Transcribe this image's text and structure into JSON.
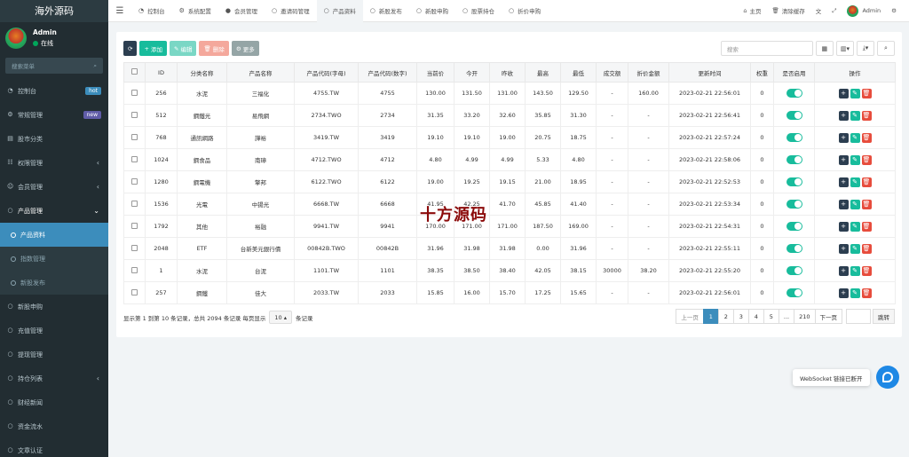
{
  "sidebar": {
    "logo": "海外源码",
    "user": {
      "name": "Admin",
      "status": "在线"
    },
    "search_placeholder": "搜索菜单",
    "menu": [
      {
        "label": "控制台",
        "icon": "dashboard-icon",
        "badge": "hot",
        "badge_color": "#3c8dbc"
      },
      {
        "label": "常规管理",
        "icon": "cogs-icon",
        "badge": "new",
        "badge_color": "#605ca8"
      },
      {
        "label": "股市分类",
        "icon": "folder-icon"
      },
      {
        "label": "权限管理",
        "icon": "group-icon",
        "arrow": "‹"
      },
      {
        "label": "会员管理",
        "icon": "users-icon",
        "arrow": "‹"
      }
    ],
    "open_menu": {
      "label": "产品管理",
      "arrow": "⌄"
    },
    "submenu": [
      {
        "label": "产品资料",
        "active": true
      },
      {
        "label": "指数管理",
        "active": false
      },
      {
        "label": "新股发布",
        "active": false
      }
    ],
    "menu_after": [
      {
        "label": "新股申购",
        "icon": "circle-icon"
      },
      {
        "label": "充值管理",
        "icon": "circle-icon"
      },
      {
        "label": "提现管理",
        "icon": "circle-icon"
      },
      {
        "label": "持仓列表",
        "icon": "circle-icon",
        "arrow": "‹"
      },
      {
        "label": "财经新闻",
        "icon": "circle-icon"
      },
      {
        "label": "资金流水",
        "icon": "circle-icon"
      },
      {
        "label": "文章认证",
        "icon": "circle-icon"
      }
    ]
  },
  "topbar": {
    "tabs": [
      {
        "label": "控制台",
        "icon": "dashboard-icon"
      },
      {
        "label": "系统配置",
        "icon": "cog-icon"
      },
      {
        "label": "会员管理",
        "icon": "user-icon"
      },
      {
        "label": "邀请码管理",
        "icon": "circle-icon"
      },
      {
        "label": "产品资料",
        "icon": "circle-icon",
        "active": true
      },
      {
        "label": "新股发布",
        "icon": "circle-icon"
      },
      {
        "label": "新股申购",
        "icon": "circle-icon"
      },
      {
        "label": "股票持仓",
        "icon": "circle-icon"
      },
      {
        "label": "折价申购",
        "icon": "circle-icon"
      }
    ],
    "home": "主页",
    "clear_cache": "清除缓存",
    "admin": "Admin"
  },
  "toolbar": {
    "refresh": "⟳",
    "add": "添加",
    "edit": "编辑",
    "delete": "删除",
    "more": "更多",
    "search_placeholder": "搜索"
  },
  "colors": {
    "refresh": "#2c3e50",
    "add": "#18bc9c",
    "edit": "#7ad7c5",
    "delete": "#f4a89c",
    "more": "#95a5a6",
    "op_add": "#2c3e50",
    "op_edit": "#18bc9c",
    "op_delete": "#e74c3c"
  },
  "table": {
    "headers": [
      "",
      "ID",
      "分类名称",
      "产品名称",
      "产品代码(字母)",
      "产品代码(数字)",
      "当前价",
      "今开",
      "昨收",
      "最高",
      "最低",
      "成交额",
      "折价金额",
      "更新时间",
      "权重",
      "是否启用",
      "操作"
    ],
    "rows": [
      [
        "256",
        "水泥",
        "三福化",
        "4755.TW",
        "4755",
        "130.00",
        "131.50",
        "131.00",
        "143.50",
        "129.50",
        "-",
        "160.00",
        "2023-02-21 22:56:01",
        "0"
      ],
      [
        "512",
        "鋼鐵光",
        "易飛網",
        "2734.TWO",
        "2734",
        "31.35",
        "33.20",
        "32.60",
        "35.85",
        "31.30",
        "-",
        "-",
        "2023-02-21 22:56:41",
        "0"
      ],
      [
        "768",
        "通訊網路",
        "譁裕",
        "3419.TW",
        "3419",
        "19.10",
        "19.10",
        "19.00",
        "20.75",
        "18.75",
        "-",
        "-",
        "2023-02-21 22:57:24",
        "0"
      ],
      [
        "1024",
        "鋼食品",
        "南璋",
        "4712.TWO",
        "4712",
        "4.80",
        "4.99",
        "4.99",
        "5.33",
        "4.80",
        "-",
        "-",
        "2023-02-21 22:58:06",
        "0"
      ],
      [
        "1280",
        "鋼電機",
        "擎邦",
        "6122.TWO",
        "6122",
        "19.00",
        "19.25",
        "19.15",
        "21.00",
        "18.95",
        "-",
        "-",
        "2023-02-21 22:52:53",
        "0"
      ],
      [
        "1536",
        "光電",
        "中揚光",
        "6668.TW",
        "6668",
        "41.95",
        "42.25",
        "41.70",
        "45.85",
        "41.40",
        "-",
        "-",
        "2023-02-21 22:53:34",
        "0"
      ],
      [
        "1792",
        "其他",
        "裕融",
        "9941.TW",
        "9941",
        "170.00",
        "171.00",
        "171.00",
        "187.50",
        "169.00",
        "-",
        "-",
        "2023-02-21 22:54:31",
        "0"
      ],
      [
        "2048",
        "ETF",
        "台新美元銀行債",
        "00842B.TWO",
        "00842B",
        "31.96",
        "31.98",
        "31.98",
        "0.00",
        "31.96",
        "-",
        "-",
        "2023-02-21 22:55:11",
        "0"
      ],
      [
        "1",
        "水泥",
        "台泥",
        "1101.TW",
        "1101",
        "38.35",
        "38.50",
        "38.40",
        "42.05",
        "38.15",
        "30000",
        "38.20",
        "2023-02-21 22:55:20",
        "0"
      ],
      [
        "257",
        "鋼鐵",
        "佳大",
        "2033.TW",
        "2033",
        "15.85",
        "16.00",
        "15.70",
        "17.25",
        "15.65",
        "-",
        "-",
        "2023-02-21 22:56:01",
        "0"
      ]
    ]
  },
  "footer": {
    "summary_prefix": "显示第 1 到第 10 条记录，总共 2094 条记录 每页显示",
    "page_size": "10",
    "summary_suffix": "条记录",
    "prev": "上一页",
    "pages": [
      "1",
      "2",
      "3",
      "4",
      "5",
      "...",
      "210"
    ],
    "next": "下一页",
    "jump": "跳转"
  },
  "watermark": "十方源码",
  "websocket_tip": "WebSocket 链接已断开"
}
